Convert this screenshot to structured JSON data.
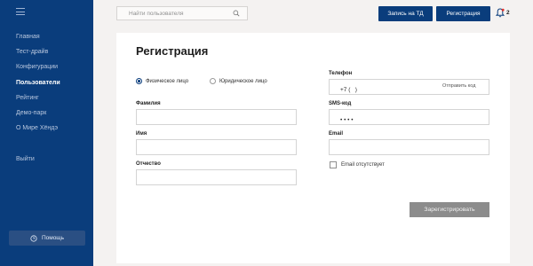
{
  "sidebar": {
    "menu_icon": "hamburger-icon",
    "items": [
      {
        "label": "Главная",
        "active": false
      },
      {
        "label": "Тест-драйв",
        "active": false
      },
      {
        "label": "Конфигурации",
        "active": false
      },
      {
        "label": "Пользователи",
        "active": true
      },
      {
        "label": "Рейтинг",
        "active": false
      },
      {
        "label": "Демо-парк",
        "active": false
      },
      {
        "label": "О Мире Хёндэ",
        "active": false
      }
    ],
    "logout_label": "Выйти",
    "help_label": "Помощь",
    "help_icon": "clock-icon"
  },
  "header": {
    "search_placeholder": "Найти пользователя",
    "search_icon": "search-icon",
    "td_button": "Запись на ТД",
    "register_button": "Регистрация",
    "bell_icon": "bell-icon",
    "notification_count": "2"
  },
  "form": {
    "title": "Регистрация",
    "person_type": {
      "options": [
        "Физическое лицо",
        "Юридическое лицо"
      ],
      "selected": "Физическое лицо"
    },
    "lastname_label": "Фамилия",
    "lastname_value": "",
    "firstname_label": "Имя",
    "firstname_value": "",
    "middlename_label": "Отчество",
    "middlename_value": "",
    "phone_label": "Телефон",
    "phone_value": "+7 (   )",
    "phone_send_code": "Отправить код",
    "sms_label": "SMS-код",
    "sms_value": "• • • •",
    "email_label": "Email",
    "email_value": "",
    "email_missing_label": "Email отсутствует",
    "email_missing_checked": false,
    "submit_label": "Зарегистрировать"
  },
  "colors": {
    "brand": "#0a3d7c",
    "submit_disabled": "#8c8c8c",
    "page_bg": "#f4f2f1"
  }
}
